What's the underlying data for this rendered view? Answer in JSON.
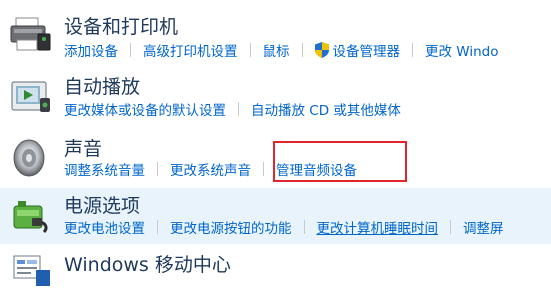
{
  "devices": {
    "title": "设备和打印机",
    "links": [
      "添加设备",
      "高级打印机设置",
      "鼠标",
      "设备管理器",
      "更改 Windo"
    ]
  },
  "autoplay": {
    "title": "自动播放",
    "links": [
      "更改媒体或设备的默认设置",
      "自动播放 CD 或其他媒体"
    ]
  },
  "sound": {
    "title": "声音",
    "links": [
      "调整系统音量",
      "更改系统声音",
      "管理音频设备"
    ]
  },
  "power": {
    "title": "电源选项",
    "links": [
      "更改电池设置",
      "更改电源按钮的功能",
      "更改计算机睡眠时间",
      "调整屏"
    ]
  },
  "mobility": {
    "title": "Windows 移动中心"
  },
  "colors": {
    "title": "#1e395b",
    "link": "#0066cc",
    "highlight": "#e0262b",
    "hover_bg": "#e8f3fb"
  }
}
